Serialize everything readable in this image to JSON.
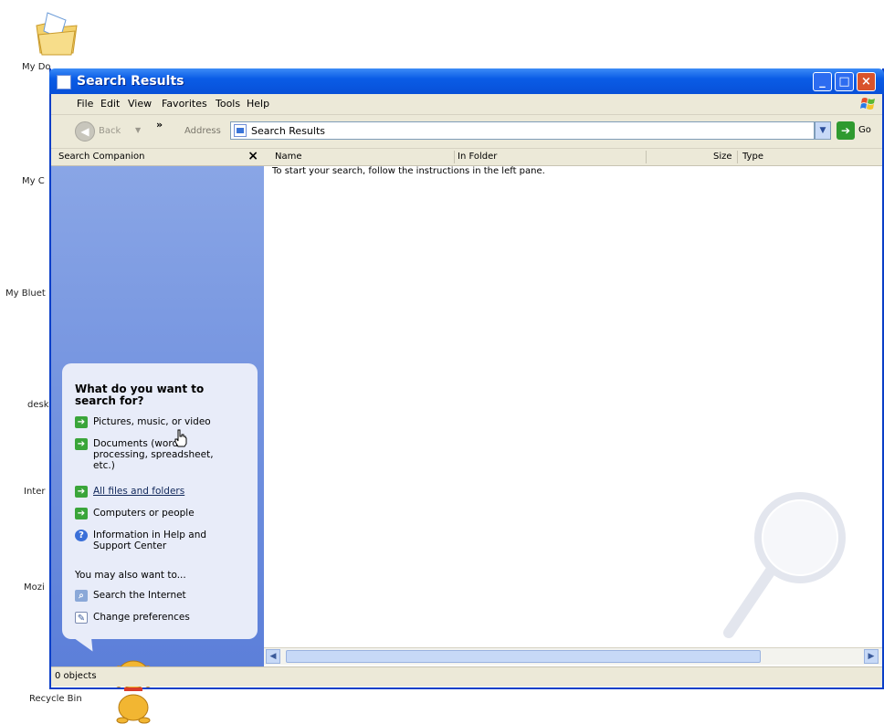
{
  "desktop": {
    "icons": [
      {
        "label": "My Do"
      },
      {
        "label": "My C"
      },
      {
        "label": "My Bluet"
      },
      {
        "label": "desk"
      },
      {
        "label": "Inter"
      },
      {
        "label": "Mozi"
      },
      {
        "label": "Recycle Bin"
      }
    ]
  },
  "window": {
    "title": "Search Results",
    "menu": [
      "File",
      "Edit",
      "View",
      "Favorites",
      "Tools",
      "Help"
    ],
    "toolbar": {
      "back_label": "Back",
      "address_label": "Address",
      "address_value": "Search Results",
      "go_label": "Go"
    },
    "search_pane": {
      "title": "Search Companion",
      "close_glyph": "×",
      "question": "What do you want to search for?",
      "options": [
        {
          "label": "Pictures, music, or video",
          "icon": "arrow-icon"
        },
        {
          "label": "Documents (word processing, spreadsheet, etc.)",
          "icon": "arrow-icon"
        },
        {
          "label": "All files and folders",
          "icon": "arrow-icon"
        },
        {
          "label": "Computers or people",
          "icon": "arrow-icon"
        },
        {
          "label": "Information in Help and Support Center",
          "icon": "help-icon"
        }
      ],
      "also_label": "You may also want to...",
      "also_options": [
        {
          "label": "Search the Internet",
          "icon": "search-icon"
        },
        {
          "label": "Change preferences",
          "icon": "preferences-icon"
        }
      ]
    },
    "results": {
      "columns": [
        "Name",
        "In Folder",
        "Size",
        "Type"
      ],
      "hint": "To start your search, follow the instructions in the left pane."
    },
    "status": "0 objects"
  }
}
